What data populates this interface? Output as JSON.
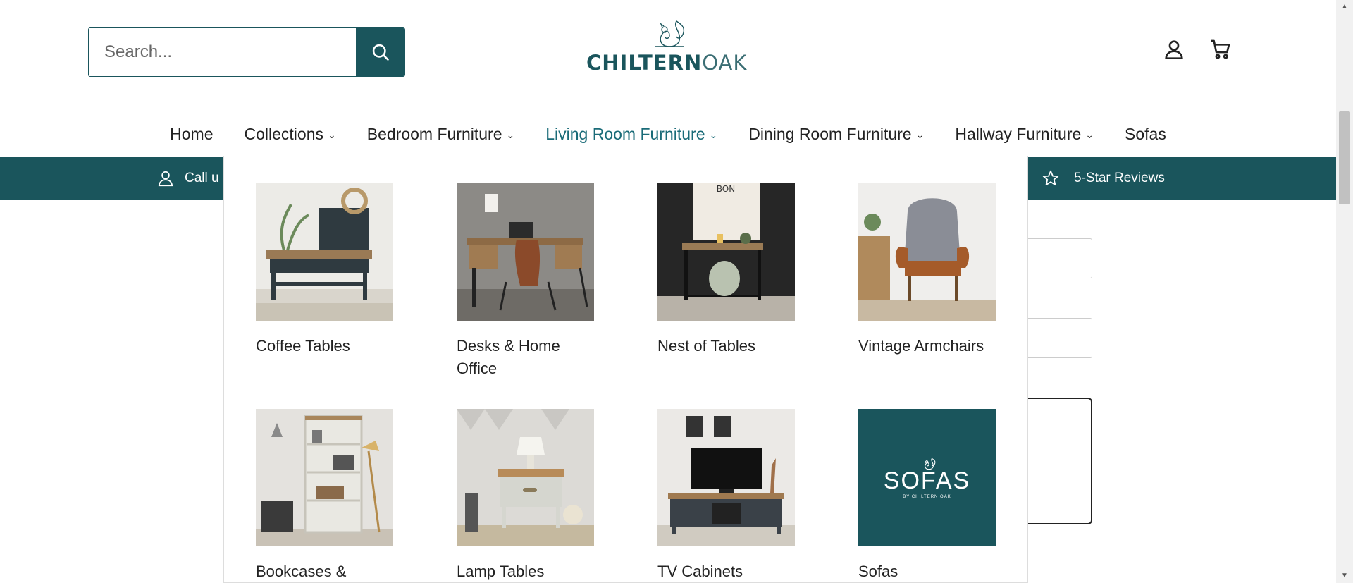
{
  "search": {
    "placeholder": "Search..."
  },
  "logo": {
    "text_bold": "CHILTERN",
    "text_light": "OAK"
  },
  "header_icons": [
    "account-icon",
    "cart-icon"
  ],
  "nav": [
    {
      "label": "Home",
      "dropdown": false,
      "active": false
    },
    {
      "label": "Collections",
      "dropdown": true,
      "active": false
    },
    {
      "label": "Bedroom Furniture",
      "dropdown": true,
      "active": false
    },
    {
      "label": "Living Room Furniture",
      "dropdown": true,
      "active": true
    },
    {
      "label": "Dining Room Furniture",
      "dropdown": true,
      "active": false
    },
    {
      "label": "Hallway Furniture",
      "dropdown": true,
      "active": false
    },
    {
      "label": "Sofas",
      "dropdown": false,
      "active": false
    }
  ],
  "teal_bar": {
    "left_text": "Call u",
    "right_text": "5-Star Reviews"
  },
  "mega_menu": {
    "items": [
      {
        "label": "Coffee Tables",
        "image": "coffee-table"
      },
      {
        "label": "Desks & Home Office",
        "image": "desk"
      },
      {
        "label": "Nest of Tables",
        "image": "nest-of-tables"
      },
      {
        "label": "Vintage Armchairs",
        "image": "armchair"
      },
      {
        "label": "Bookcases & Shelving",
        "image": "bookcase"
      },
      {
        "label": "Lamp Tables",
        "image": "lamp-table"
      },
      {
        "label": "TV Cabinets",
        "image": "tv-cabinet"
      },
      {
        "label": "Sofas",
        "image": "sofas-logo",
        "tile_text": "SOFAS",
        "tile_subtext": "BY CHILTERN OAK"
      }
    ]
  },
  "colors": {
    "brand": "#1a555c",
    "active_nav": "#1a6b78"
  }
}
